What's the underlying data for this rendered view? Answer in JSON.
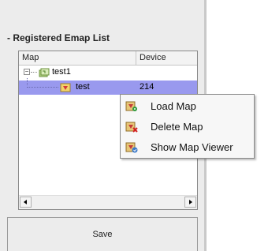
{
  "panel": {
    "section_title": "- Registered Emap List",
    "save_label": "Save"
  },
  "list": {
    "columns": [
      "Map",
      "Device"
    ],
    "rows": [
      {
        "label": "test1",
        "device": "",
        "expanded": true,
        "icon": "map-folder-icon"
      },
      {
        "label": "test",
        "device": "214",
        "selected": true,
        "icon": "map-node-icon"
      }
    ],
    "expander_symbol": "−"
  },
  "context_menu": {
    "items": [
      {
        "label": "Load Map",
        "icon": "load-map-icon"
      },
      {
        "label": "Delete Map",
        "icon": "delete-map-icon"
      },
      {
        "label": "Show Map Viewer",
        "icon": "show-map-viewer-icon"
      }
    ]
  },
  "colors": {
    "selection": "#9999ee",
    "panel_bg": "#ececec"
  }
}
